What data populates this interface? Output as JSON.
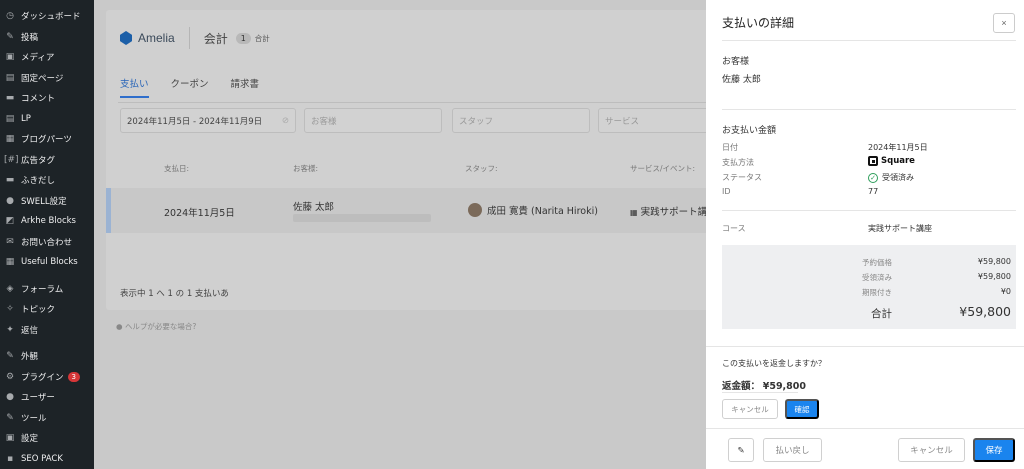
{
  "sidebar": {
    "items": [
      {
        "label": "ダッシュボード",
        "icon": "dashboard-icon",
        "glyph": "◷"
      },
      {
        "label": "投稿",
        "icon": "pin-icon",
        "glyph": "✎"
      },
      {
        "label": "メディア",
        "icon": "media-icon",
        "glyph": "▣"
      },
      {
        "label": "固定ページ",
        "icon": "page-icon",
        "glyph": "▤"
      },
      {
        "label": "コメント",
        "icon": "comment-icon",
        "glyph": "▬"
      },
      {
        "label": "LP",
        "icon": "lp-icon",
        "glyph": "▤"
      },
      {
        "label": "ブログパーツ",
        "icon": "blog-parts-icon",
        "glyph": "▦"
      },
      {
        "label": "広告タグ",
        "icon": "ad-tag-icon",
        "glyph": "[#]"
      },
      {
        "label": "ふきだし",
        "icon": "balloon-icon",
        "glyph": "▬"
      },
      {
        "label": "SWELL設定",
        "icon": "swell-icon",
        "glyph": "●"
      },
      {
        "label": "Arkhe Blocks",
        "icon": "arkhe-icon",
        "glyph": "◩"
      },
      {
        "label": "お問い合わせ",
        "icon": "mail-icon",
        "glyph": "✉"
      },
      {
        "label": "Useful Blocks",
        "icon": "blocks-icon",
        "glyph": "▦"
      },
      {
        "label": "フォーラム",
        "icon": "forum-icon",
        "glyph": "◈"
      },
      {
        "label": "トピック",
        "icon": "topic-icon",
        "glyph": "✧"
      },
      {
        "label": "返信",
        "icon": "reply-icon",
        "glyph": "✦"
      },
      {
        "label": "外観",
        "icon": "appearance-icon",
        "glyph": "✎"
      },
      {
        "label": "プラグイン",
        "icon": "plugin-icon",
        "glyph": "⚙"
      },
      {
        "label": "ユーザー",
        "icon": "user-icon",
        "glyph": "●"
      },
      {
        "label": "ツール",
        "icon": "tool-icon",
        "glyph": "✎"
      },
      {
        "label": "設定",
        "icon": "settings-icon",
        "glyph": "▣"
      },
      {
        "label": "SEO PACK",
        "icon": "seo-icon",
        "glyph": "▪"
      }
    ],
    "plugin_badge": "3"
  },
  "amelia": {
    "logo": "Amelia",
    "title": "会計",
    "count": "1",
    "count_label": "合計",
    "tabs": [
      "支払い",
      "クーポン",
      "請求書"
    ],
    "filters": {
      "date": "2024年11月5日 - 2024年11月9日",
      "customer_placeholder": "お客様",
      "staff_placeholder": "スタッフ",
      "service_placeholder": "サービス"
    },
    "columns": [
      "支払日:",
      "お客様:",
      "スタッフ:",
      "サービス/イベント:"
    ],
    "row": {
      "date": "2024年11月5日",
      "customer": "佐藤 太郎",
      "staff": "成田 寛貴 (Narita Hiroki)",
      "service": "実践サポート講"
    },
    "footer": "表示中 1 へ 1 の 1 支払いあ",
    "help": "ヘルプが必要な場合?"
  },
  "drawer": {
    "title": "支払いの詳細",
    "close": "×",
    "customer_section": "お客様",
    "customer_name": "佐藤 太郎",
    "amount_section": "お支払い金額",
    "fields": {
      "date_label": "日付",
      "date_value": "2024年11月5日",
      "method_label": "支払方法",
      "method_value": "Square",
      "status_label": "ステータス",
      "status_value": "受領済み",
      "id_label": "ID",
      "id_value": "77",
      "course_label": "コース",
      "course_value": "実践サポート講座"
    },
    "summary": {
      "price_label": "予約価格",
      "price_value": "¥59,800",
      "received_label": "受領済み",
      "received_value": "¥59,800",
      "due_label": "期限付き",
      "due_value": "¥0",
      "total_label": "合計",
      "total_value": "¥59,800"
    },
    "refund": {
      "question": "この支払いを返金しますか？",
      "amount_label": "返金額：",
      "amount_value": "¥59,800",
      "cancel": "キャンセル",
      "confirm": "確認"
    },
    "footer": {
      "refund_button": "払い戻し",
      "cancel": "キャンセル",
      "save": "保存"
    }
  },
  "colors": {
    "accent": "#1a84ee",
    "sidebar_bg": "#1d2327",
    "status_green": "#2e9e5b"
  }
}
